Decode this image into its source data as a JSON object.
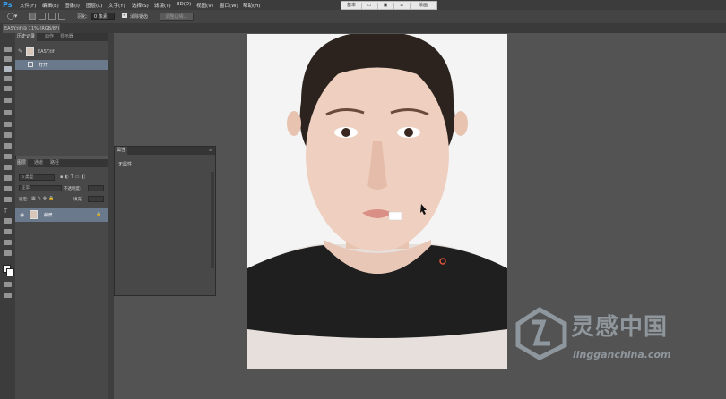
{
  "app": {
    "logo": "Ps"
  },
  "menu": [
    "文件(F)",
    "编辑(E)",
    "图像(I)",
    "图层(L)",
    "文字(Y)",
    "选择(S)",
    "滤镜(T)",
    "3D(D)",
    "视图(V)",
    "窗口(W)",
    "帮助(H)"
  ],
  "workspace": {
    "left_label": "基本",
    "right_label": "绘画"
  },
  "options": {
    "feather_label": "羽化:",
    "feather_value": "0 像素",
    "antialias_label": "消除锯齿",
    "refine_label": "调整边缘..."
  },
  "document": {
    "tab_title": "EASY.tif @ 11% (RGB/8*)"
  },
  "history": {
    "tabs": [
      "历史记录",
      "动作",
      "显示器"
    ],
    "snapshot": "EASY.tif",
    "state": "打开"
  },
  "layers": {
    "tabs": [
      "图层",
      "通道",
      "路径"
    ],
    "kind": "ρ 类型",
    "blend": "正常",
    "opacity_label": "不透明度:",
    "lock_label": "锁定:",
    "fill_label": "填充:",
    "layer_name": "背景"
  },
  "properties": {
    "title": "属性",
    "text": "无属性"
  },
  "watermark": {
    "cn": "灵感中国",
    "en": "lingganchina.com"
  },
  "colors": {
    "bg": "#535353",
    "panel": "#484848",
    "selected": "#6a7a8c",
    "accent": "#31a8ff"
  }
}
